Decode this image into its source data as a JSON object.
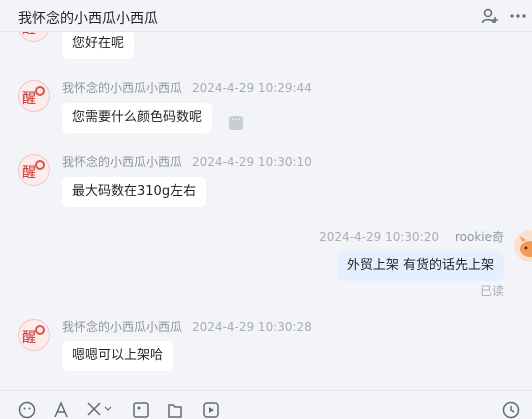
{
  "header": {
    "title": "我怀念的小西瓜小西瓜",
    "icons": [
      "add-member-icon",
      "more-icon"
    ]
  },
  "messages": [
    {
      "sender": "",
      "time": "",
      "text": "您好在呢"
    },
    {
      "sender": "我怀念的小西瓜小西瓜",
      "time": "2024-4-29 10:29:44",
      "text": "您需要什么颜色码数呢"
    },
    {
      "sender": "我怀念的小西瓜小西瓜",
      "time": "2024-4-29 10:30:10",
      "text": "最大码数在310g左右"
    },
    {
      "sender": "rookie奇",
      "time": "2024-4-29 10:30:20",
      "text": "外贸上架  有货的话先上架",
      "status": "已读"
    },
    {
      "sender": "我怀念的小西瓜小西瓜",
      "time": "2024-4-29 10:30:28",
      "text": "嗯嗯可以上架哈"
    }
  ],
  "toolbar": {
    "icons": [
      "emoji-icon",
      "font-icon",
      "scissors-icon",
      "image-icon",
      "file-icon",
      "video-icon",
      "history-icon"
    ]
  },
  "colors": {
    "background": "#f3f4f7",
    "bubble": "#ffffff",
    "my_bubble": "#e6efff",
    "meta_text": "#8f959e"
  }
}
